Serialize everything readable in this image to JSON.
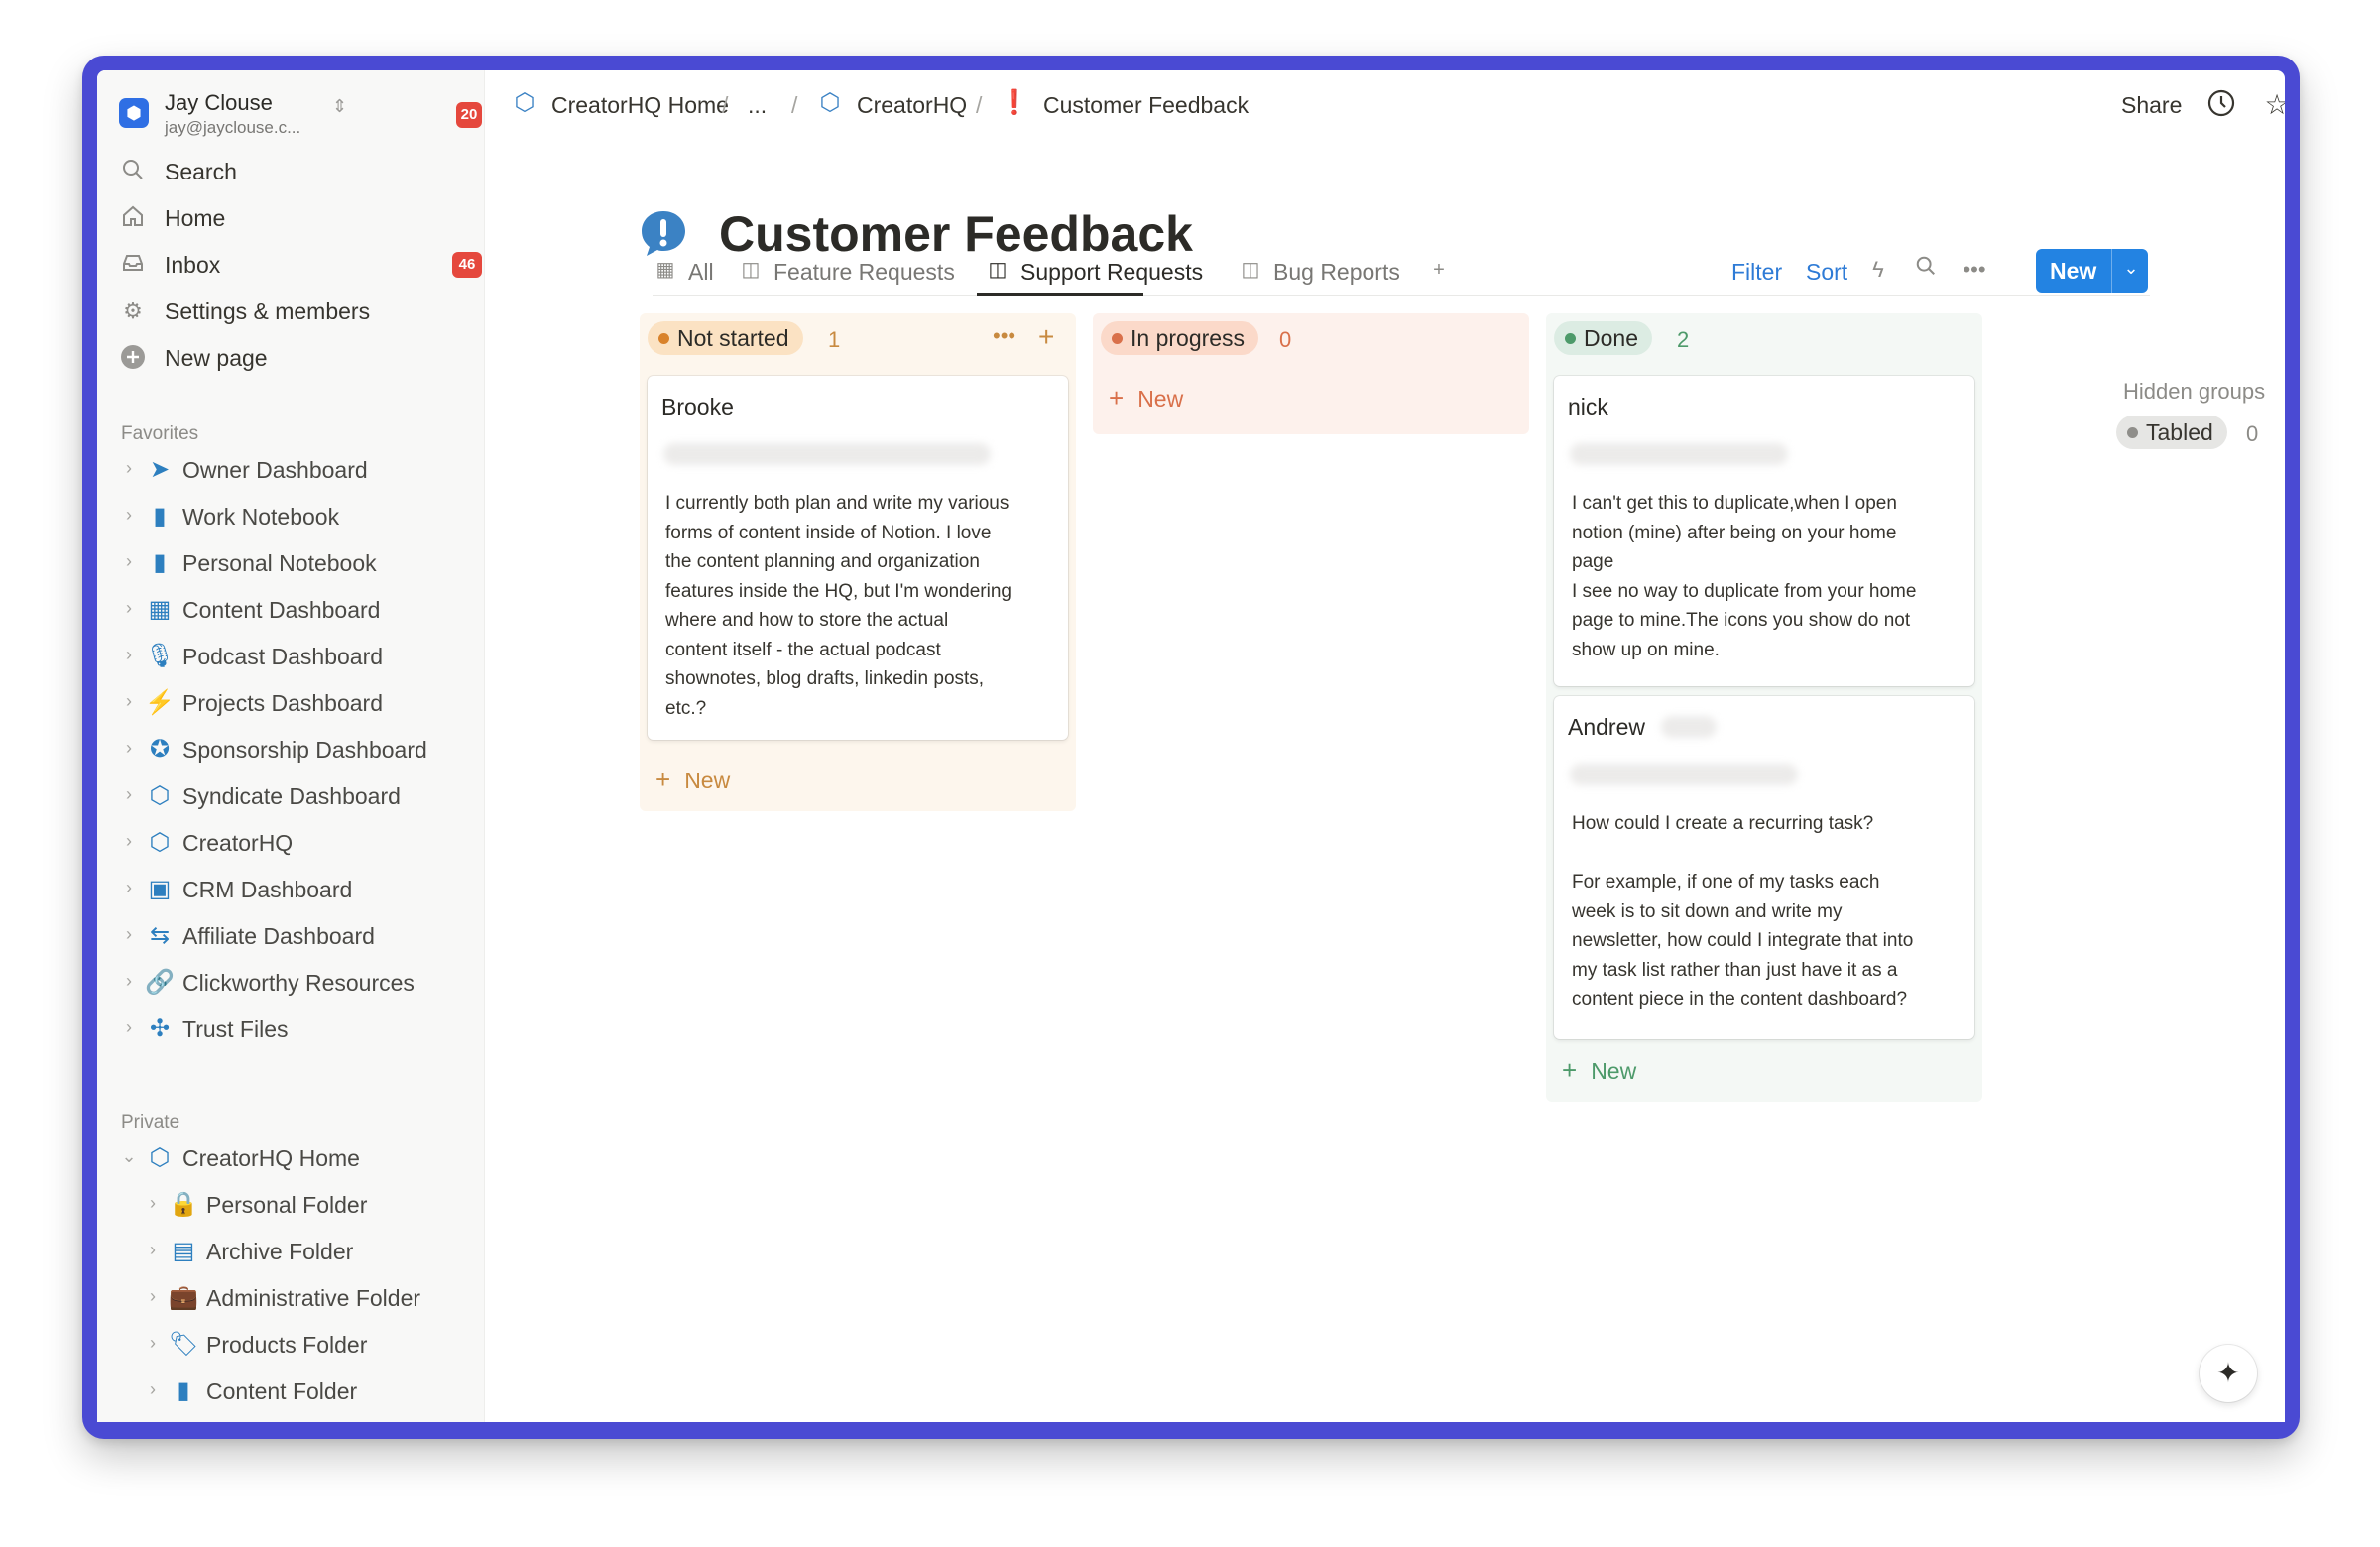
{
  "workspace": {
    "name": "Jay Clouse",
    "email": "jay@jayclouse.c...",
    "badge": "20"
  },
  "nav": {
    "search": "Search",
    "home": "Home",
    "inbox": "Inbox",
    "inbox_badge": "46",
    "settings": "Settings & members",
    "new_page": "New page"
  },
  "favorites": {
    "label": "Favorites",
    "items": [
      {
        "label": "Owner Dashboard",
        "icon": "paper-plane-icon"
      },
      {
        "label": "Work Notebook",
        "icon": "notebook-icon"
      },
      {
        "label": "Personal Notebook",
        "icon": "notebook-icon"
      },
      {
        "label": "Content Dashboard",
        "icon": "calendar-icon"
      },
      {
        "label": "Podcast Dashboard",
        "icon": "microphone-icon"
      },
      {
        "label": "Projects Dashboard",
        "icon": "lightning-icon"
      },
      {
        "label": "Sponsorship Dashboard",
        "icon": "star-badge-icon"
      },
      {
        "label": "Syndicate Dashboard",
        "icon": "creatorhq-logo-icon"
      },
      {
        "label": "CreatorHQ",
        "icon": "creatorhq-logo-icon"
      },
      {
        "label": "CRM Dashboard",
        "icon": "contact-card-icon"
      },
      {
        "label": "Affiliate Dashboard",
        "icon": "money-transfer-icon"
      },
      {
        "label": "Clickworthy Resources",
        "icon": "link-icon"
      },
      {
        "label": "Trust Files",
        "icon": "puzzle-icon"
      }
    ]
  },
  "private": {
    "label": "Private",
    "root": "CreatorHQ Home",
    "items": [
      {
        "label": "Personal Folder",
        "icon": "lock-icon"
      },
      {
        "label": "Archive Folder",
        "icon": "archive-icon"
      },
      {
        "label": "Administrative Folder",
        "icon": "briefcase-icon"
      },
      {
        "label": "Products Folder",
        "icon": "tag-icon"
      },
      {
        "label": "Content Folder",
        "icon": "notebook-icon"
      }
    ]
  },
  "breadcrumb": [
    "CreatorHQ Home",
    "...",
    "CreatorHQ",
    "Customer Feedback"
  ],
  "topbar": {
    "share": "Share"
  },
  "page": {
    "title": "Customer Feedback"
  },
  "tabs": [
    {
      "label": "All",
      "icon": "table-icon"
    },
    {
      "label": "Feature Requests",
      "icon": "board-icon"
    },
    {
      "label": "Support Requests",
      "icon": "board-icon",
      "active": true
    },
    {
      "label": "Bug Reports",
      "icon": "board-icon"
    }
  ],
  "toolbar": {
    "filter": "Filter",
    "sort": "Sort",
    "new": "New"
  },
  "board": {
    "columns": [
      {
        "status": "Not started",
        "count": "1",
        "new_label": "New",
        "cards": [
          {
            "name": "Brooke",
            "body": "I currently both plan and write my various\nforms of content inside of Notion. I love\nthe content planning and organization\nfeatures inside the HQ, but I'm wondering\nwhere and how to store the actual\ncontent itself - the actual podcast\nshownotes, blog drafts, linkedin posts,\netc.?"
          }
        ]
      },
      {
        "status": "In progress",
        "count": "0",
        "new_label": "New",
        "cards": []
      },
      {
        "status": "Done",
        "count": "2",
        "new_label": "New",
        "cards": [
          {
            "name": "nick",
            "body": "I can't get this to duplicate,when I open\nnotion (mine) after being on your home\npage\nI see no way to duplicate from your home\npage to mine.The icons you show do not\nshow up on mine."
          },
          {
            "name": "Andrew",
            "body": "How could I create a recurring task?\n\nFor example, if one of my tasks each\nweek is to sit down and write my\nnewsletter, how could I integrate that into\nmy task list rather than just have it as a\ncontent piece in the content dashboard?"
          }
        ]
      }
    ],
    "hidden_groups": {
      "label": "Hidden groups",
      "items": [
        {
          "status": "Tabled",
          "count": "0"
        }
      ]
    }
  },
  "colors": {
    "accent": "#2383e2",
    "not_started_bg": "#fdf6ed",
    "in_progress_bg": "#fdf1ec",
    "done_bg": "#f4f8f5",
    "badge_red": "#e5483d"
  }
}
